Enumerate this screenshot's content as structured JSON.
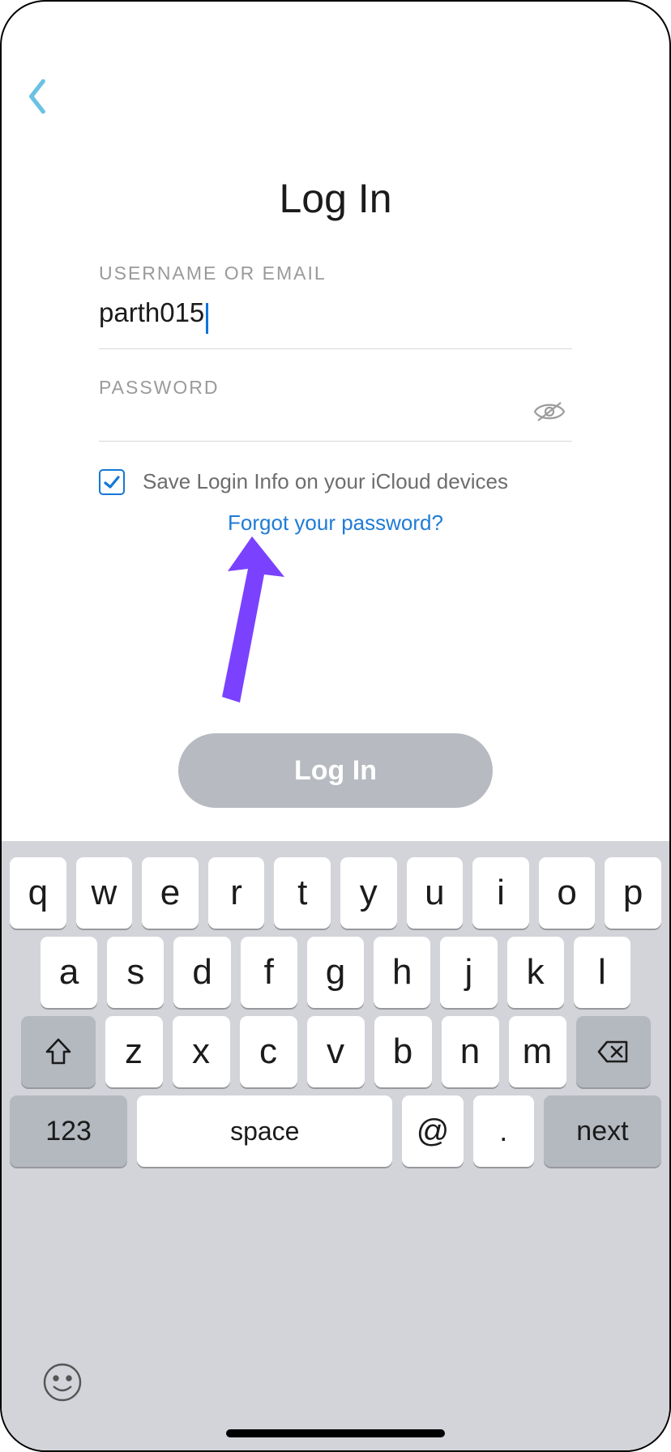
{
  "header": {
    "title": "Log In"
  },
  "form": {
    "username_label": "USERNAME OR EMAIL",
    "username_value": "parth015",
    "password_label": "PASSWORD",
    "password_value": "",
    "save_label": "Save Login Info on your iCloud devices",
    "save_checked": true
  },
  "links": {
    "forgot": "Forgot your password?"
  },
  "buttons": {
    "login": "Log In"
  },
  "keyboard": {
    "row1": [
      "q",
      "w",
      "e",
      "r",
      "t",
      "y",
      "u",
      "i",
      "o",
      "p"
    ],
    "row2": [
      "a",
      "s",
      "d",
      "f",
      "g",
      "h",
      "j",
      "k",
      "l"
    ],
    "row3": [
      "z",
      "x",
      "c",
      "v",
      "b",
      "n",
      "m"
    ],
    "numbers": "123",
    "space": "space",
    "at": "@",
    "dot": ".",
    "next": "next"
  }
}
